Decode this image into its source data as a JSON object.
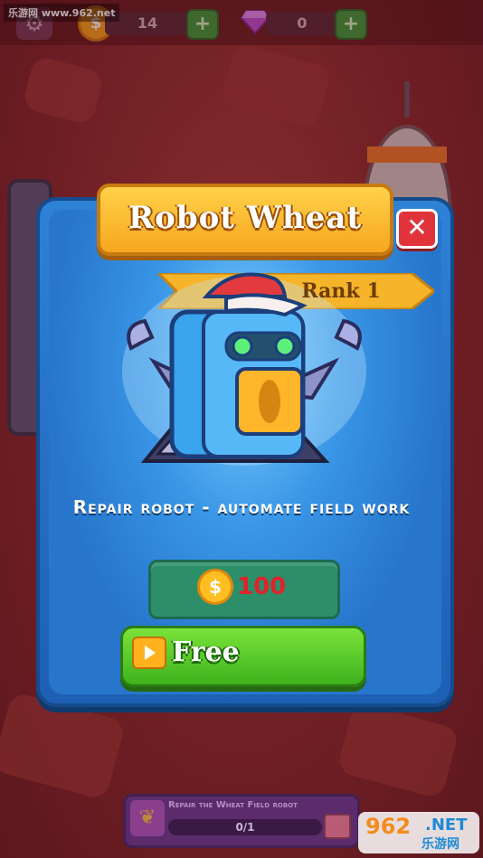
{
  "watermark_top": "乐游网 www.962.net",
  "topbar": {
    "gear_icon": "gear-icon",
    "coins": "14",
    "coin_icon": "$",
    "gems": "0",
    "plus_icon": "+"
  },
  "dialog": {
    "title": "Robot Wheat",
    "close_icon": "✕",
    "rank_label": "Rank 1",
    "description": "Repair robot - automate field work",
    "price_coin_icon": "$",
    "price": "100",
    "free_label": "Free"
  },
  "quest": {
    "icon": "wheat-icon",
    "title": "Repair the Wheat Field robot",
    "progress": "0/1"
  },
  "watermark_br": {
    "num": "962",
    "net": ".NET",
    "cn": "乐游网"
  },
  "colors": {
    "panel": "#2e82d6",
    "title": "#f6a61e",
    "free_button": "#3eb21d",
    "price_box": "#2d8e6a",
    "price_text": "#e0232a"
  }
}
